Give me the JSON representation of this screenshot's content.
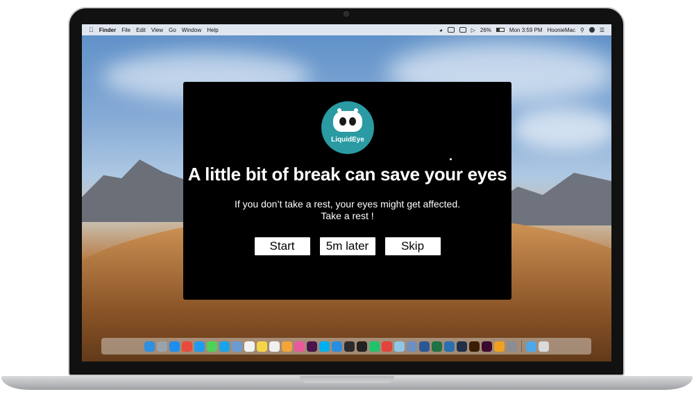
{
  "menubar": {
    "items": [
      "Finder",
      "File",
      "Edit",
      "View",
      "Go",
      "Window",
      "Help"
    ],
    "battery": "26%",
    "clock": "Mon 3:59 PM",
    "user": "HoonieMac",
    "icons": [
      "apple-icon",
      "wifi-icon",
      "keyboard-icon",
      "airplay-icon",
      "volume-icon",
      "battery-icon",
      "search-icon",
      "siri-icon",
      "notification-center-icon"
    ]
  },
  "dialog": {
    "logo_text": "LiquidEye",
    "headline": "A little bit of break can save your eyes",
    "message_line1": "If you don’t take a rest, your eyes might get affected.",
    "message_line2": "Take a rest !",
    "buttons": {
      "start": "Start",
      "later": "5m later",
      "skip": "Skip"
    }
  },
  "dock": {
    "apps": [
      {
        "name": "finder",
        "color": "#2f8fe0"
      },
      {
        "name": "launchpad",
        "color": "#9aa3ad"
      },
      {
        "name": "safari",
        "color": "#1d8ef0"
      },
      {
        "name": "chrome",
        "color": "#e84a3c"
      },
      {
        "name": "app-store",
        "color": "#1e9bf0"
      },
      {
        "name": "messages",
        "color": "#4fd25a"
      },
      {
        "name": "skype",
        "color": "#1ba3e8"
      },
      {
        "name": "preview",
        "color": "#6c9bd2"
      },
      {
        "name": "calendar",
        "color": "#f2f2f2"
      },
      {
        "name": "notes",
        "color": "#f5d547"
      },
      {
        "name": "reminders",
        "color": "#f0f0f0"
      },
      {
        "name": "photos",
        "color": "#f3a43b"
      },
      {
        "name": "itunes",
        "color": "#e85a9b"
      },
      {
        "name": "slack",
        "color": "#4a154b"
      },
      {
        "name": "skype-alt",
        "color": "#00aff0"
      },
      {
        "name": "xcode",
        "color": "#2a8ee0"
      },
      {
        "name": "terminal",
        "color": "#2b2b2b"
      },
      {
        "name": "github",
        "color": "#222222"
      },
      {
        "name": "pycharm",
        "color": "#20c36b"
      },
      {
        "name": "git-client",
        "color": "#e0443a"
      },
      {
        "name": "snowflake",
        "color": "#8fc7e8"
      },
      {
        "name": "r",
        "color": "#6f8fbf"
      },
      {
        "name": "word",
        "color": "#2b5797"
      },
      {
        "name": "excel",
        "color": "#1f7244"
      },
      {
        "name": "powershell",
        "color": "#2a6fb0"
      },
      {
        "name": "photoshop",
        "color": "#1f2f4a"
      },
      {
        "name": "illustrator",
        "color": "#3a1d05"
      },
      {
        "name": "adobe-xd",
        "color": "#3a0a2e"
      },
      {
        "name": "transmit",
        "color": "#f0a020"
      },
      {
        "name": "system-preferences",
        "color": "#8a8d93"
      },
      {
        "name": "downloads",
        "color": "#4ea7e6"
      },
      {
        "name": "trash",
        "color": "#d8dadc"
      }
    ]
  }
}
